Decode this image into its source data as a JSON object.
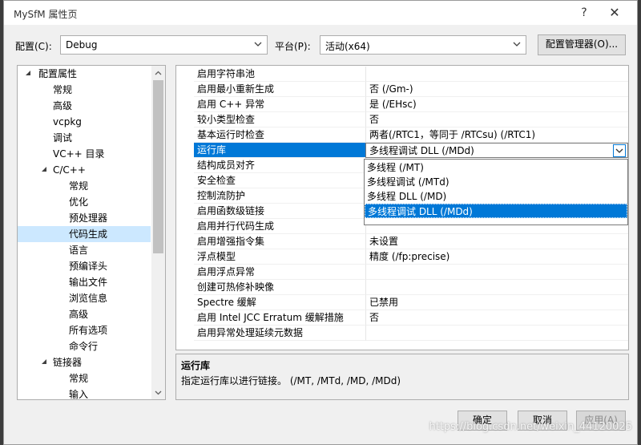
{
  "window": {
    "title": "MySfM 属性页",
    "help_glyph": "?",
    "close_glyph": "✕"
  },
  "config": {
    "config_label": "配置(C):",
    "config_value": "Debug",
    "platform_label": "平台(P):",
    "platform_value": "活动(x64)",
    "manager_button": "配置管理器(O)..."
  },
  "tree": [
    {
      "label": "配置属性",
      "level": 0,
      "toggle": "expanded"
    },
    {
      "label": "常规",
      "level": 1
    },
    {
      "label": "高级",
      "level": 1
    },
    {
      "label": "vcpkg",
      "level": 1
    },
    {
      "label": "调试",
      "level": 1
    },
    {
      "label": "VC++ 目录",
      "level": 1
    },
    {
      "label": "C/C++",
      "level": 1,
      "toggle": "expanded"
    },
    {
      "label": "常规",
      "level": 2
    },
    {
      "label": "优化",
      "level": 2
    },
    {
      "label": "预处理器",
      "level": 2
    },
    {
      "label": "代码生成",
      "level": 2,
      "selected": true
    },
    {
      "label": "语言",
      "level": 2
    },
    {
      "label": "预编译头",
      "level": 2
    },
    {
      "label": "输出文件",
      "level": 2
    },
    {
      "label": "浏览信息",
      "level": 2
    },
    {
      "label": "高级",
      "level": 2
    },
    {
      "label": "所有选项",
      "level": 2
    },
    {
      "label": "命令行",
      "level": 2
    },
    {
      "label": "链接器",
      "level": 1,
      "toggle": "expanded"
    },
    {
      "label": "常规",
      "level": 2
    },
    {
      "label": "输入",
      "level": 2
    }
  ],
  "properties": [
    {
      "name": "启用字符串池",
      "value": ""
    },
    {
      "name": "启用最小重新生成",
      "value": "否 (/Gm-)"
    },
    {
      "name": "启用 C++ 异常",
      "value": "是 (/EHsc)"
    },
    {
      "name": "较小类型检查",
      "value": "否"
    },
    {
      "name": "基本运行时检查",
      "value": "两者(/RTC1，等同于 /RTCsu) (/RTC1)"
    },
    {
      "name": "运行库",
      "value": "多线程调试 DLL (/MDd)",
      "selected": true
    },
    {
      "name": "结构成员对齐",
      "value": ""
    },
    {
      "name": "安全检查",
      "value": ""
    },
    {
      "name": "控制流防护",
      "value": ""
    },
    {
      "name": "启用函数级链接",
      "value": ""
    },
    {
      "name": "启用并行代码生成",
      "value": ""
    },
    {
      "name": "启用增强指令集",
      "value": "未设置"
    },
    {
      "name": "浮点模型",
      "value": "精度 (/fp:precise)"
    },
    {
      "name": "启用浮点异常",
      "value": ""
    },
    {
      "name": "创建可热修补映像",
      "value": ""
    },
    {
      "name": "Spectre 缓解",
      "value": "已禁用"
    },
    {
      "name": "启用 Intel JCC Erratum 缓解措施",
      "value": "否"
    },
    {
      "name": "启用异常处理延续元数据",
      "value": ""
    }
  ],
  "dropdown_options": [
    {
      "label": "多线程 (/MT)"
    },
    {
      "label": "多线程调试 (/MTd)"
    },
    {
      "label": "多线程 DLL (/MD)"
    },
    {
      "label": "多线程调试 DLL (/MDd)",
      "selected": true
    }
  ],
  "description": {
    "title": "运行库",
    "text": "指定运行库以进行链接。    (/MT, /MTd, /MD, /MDd)"
  },
  "buttons": {
    "ok": "确定",
    "cancel": "取消",
    "apply": "应用(A)"
  },
  "watermark": "https://blog.csdn.net/weixin_44120025",
  "colors": {
    "selection": "#0078d7",
    "tree_selection": "#cce8ff"
  }
}
